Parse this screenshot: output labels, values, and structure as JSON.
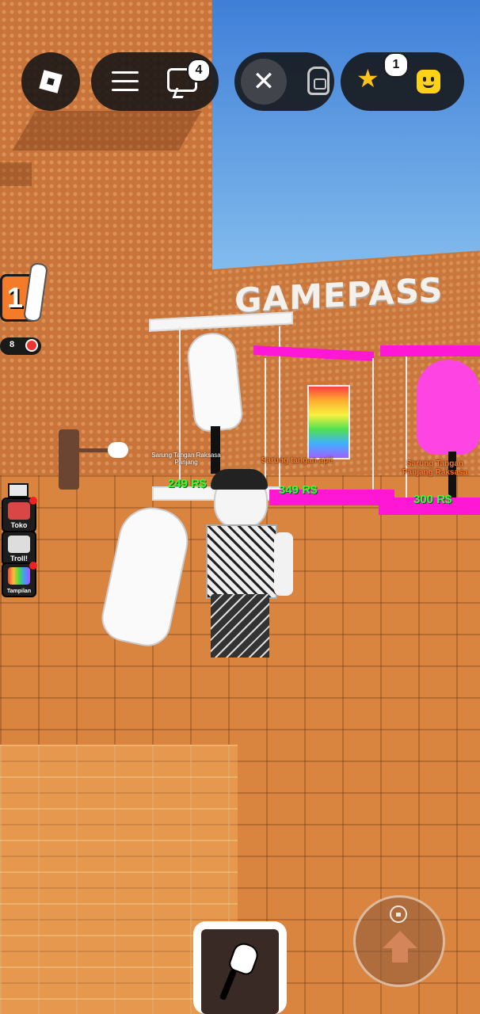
{
  "hud": {
    "chat_badge": "4",
    "notification_badge": "1",
    "close_symbol": "✕",
    "icons": [
      "roblox-logo-icon",
      "menu-icon",
      "chat-icon",
      "close-icon",
      "backpack-icon",
      "star-icon",
      "avatar-face-icon"
    ]
  },
  "stats": {
    "slap_count": "1",
    "timer_count": "8"
  },
  "side_menu": {
    "items": [
      {
        "label": "Toko"
      },
      {
        "label": "Troll!"
      },
      {
        "label": "Tampilan"
      }
    ]
  },
  "world": {
    "gamepass_sign": "GAMEPASS",
    "shop": [
      {
        "name": "Sarung Tangan Raksasa Panjang",
        "price": "249 R$"
      },
      {
        "name": "Sarung tangan api!",
        "price": "349 R$"
      },
      {
        "name": "Sarung Tangan Panjang Raksasa",
        "price": "300 R$"
      }
    ]
  },
  "colors": {
    "hud_bg": "#141416",
    "accent_orange": "#f47c28",
    "price_green": "#32ff3a",
    "pink_pad": "#ff17d6",
    "star": "#ffc21a"
  }
}
